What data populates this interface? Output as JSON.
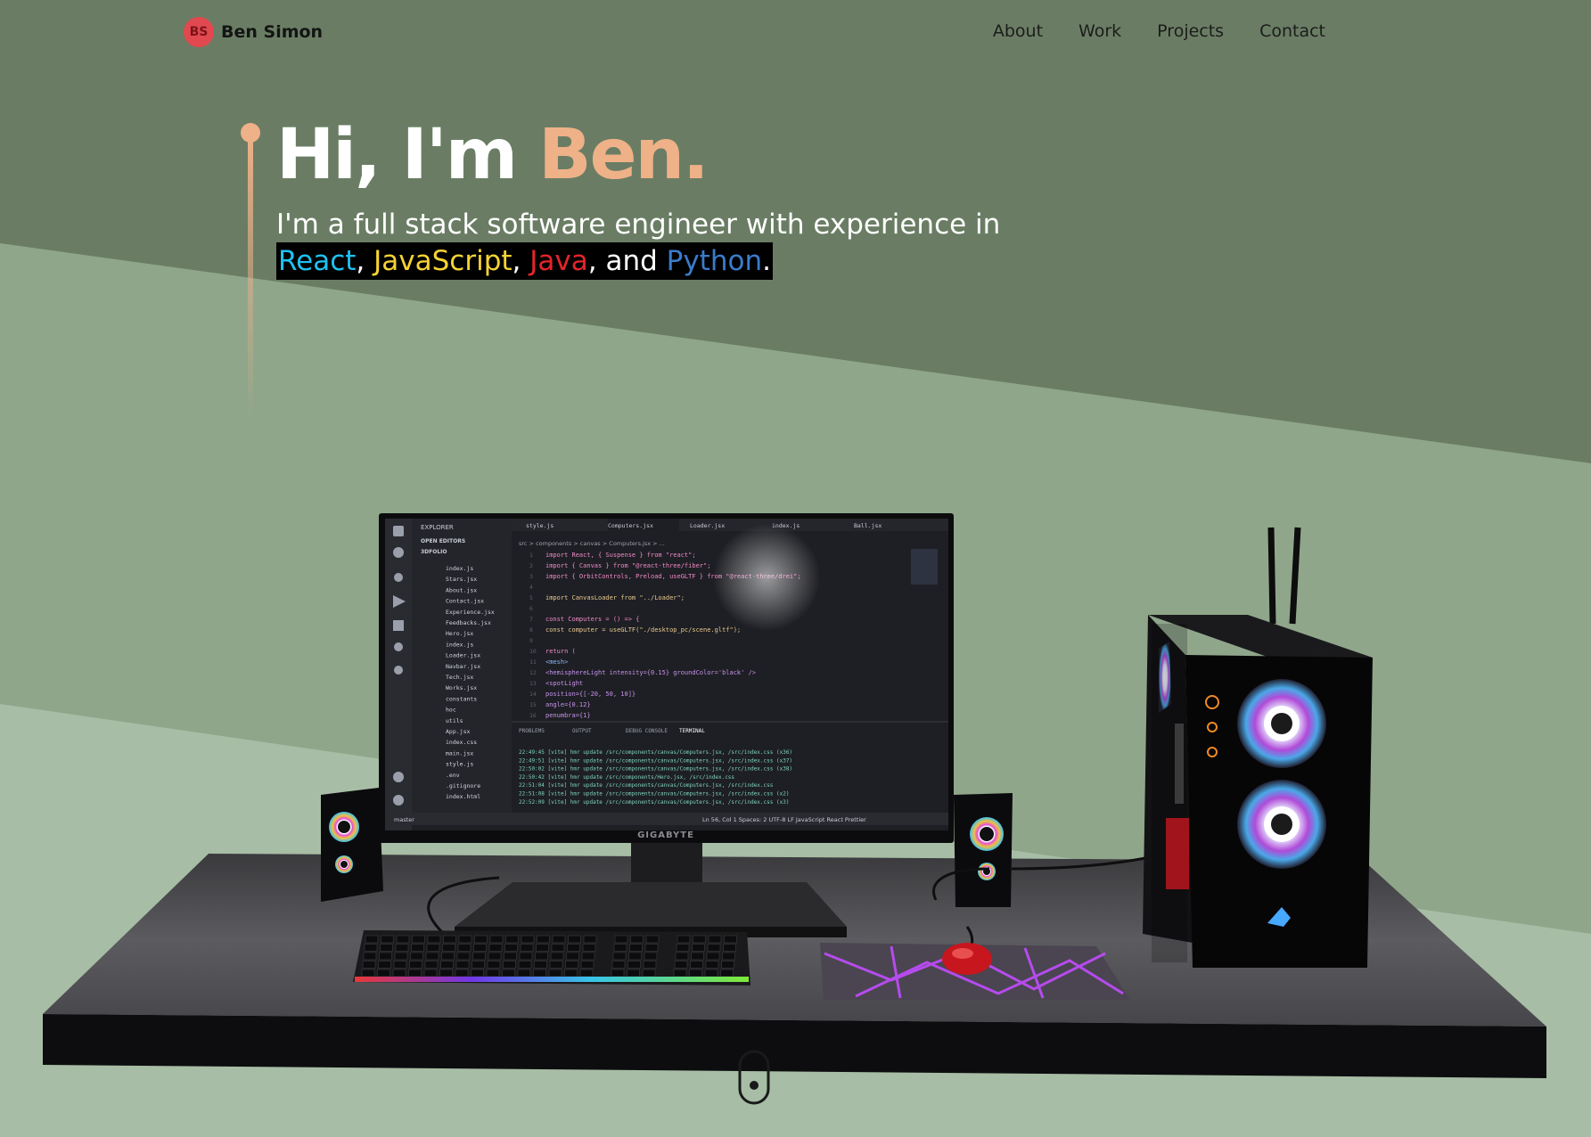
{
  "brand": {
    "logo_text": "BS",
    "name": "Ben Simon"
  },
  "nav": {
    "items": [
      "About",
      "Work",
      "Projects",
      "Contact"
    ]
  },
  "hero": {
    "greeting": "Hi, I'm ",
    "name": "Ben.",
    "subtitle": "I'm a full stack software engineer with experience in",
    "skills": {
      "react": "React",
      "sep1": ", ",
      "javascript": "JavaScript",
      "sep2": ", ",
      "java": "Java",
      "and": ", and ",
      "python": "Python",
      "end": "."
    }
  },
  "monitor": {
    "brand": "GIGABYTE",
    "explorer_title": "EXPLORER",
    "open_editors": "OPEN EDITORS",
    "project": "3DFOLIO",
    "files": [
      "index.js",
      "Stars.jsx",
      "About.jsx",
      "Contact.jsx",
      "Experience.jsx",
      "Feedbacks.jsx",
      "Hero.jsx",
      "index.js",
      "Loader.jsx",
      "Navbar.jsx",
      "Tech.jsx",
      "Works.jsx",
      "constants",
      "hoc",
      "utils",
      "App.jsx",
      "index.css",
      "main.jsx",
      "style.js",
      ".env",
      ".gitignore",
      "index.html"
    ],
    "tabs": [
      "style.js",
      "Computers.jsx",
      "Loader.jsx",
      "index.js",
      "Ball.jsx"
    ],
    "breadcrumb": "src > components > canvas > Computers.jsx > ...",
    "code_lines": [
      "import React, { Suspense } from \"react\";",
      "import { Canvas } from \"@react-three/fiber\";",
      "import { OrbitControls, Preload, useGLTF } from \"@react-three/drei\";",
      "",
      "import CanvasLoader from \"../Loader\";",
      "",
      "const Computers = () => {",
      "  const computer = useGLTF(\"./desktop_pc/scene.gltf\");",
      "",
      "  return (",
      "    <mesh>",
      "      <hemisphereLight intensity={0.15} groundColor='black' />",
      "      <spotLight",
      "        position={[-20, 50, 10]}",
      "        angle={0.12}",
      "        penumbra={1}"
    ],
    "panel_tabs": [
      "PROBLEMS",
      "OUTPUT",
      "DEBUG CONSOLE",
      "TERMINAL"
    ],
    "terminal_lines": [
      "22:49:45 [vite] hmr update /src/components/canvas/Computers.jsx, /src/index.css (x36)",
      "22:49:51 [vite] hmr update /src/components/canvas/Computers.jsx, /src/index.css (x37)",
      "22:50:02 [vite] hmr update /src/components/canvas/Computers.jsx, /src/index.css (x38)",
      "22:50:42 [vite] hmr update /src/components/Hero.jsx, /src/index.css",
      "22:51:04 [vite] hmr update /src/components/canvas/Computers.jsx, /src/index.css",
      "22:51:08 [vite] hmr update /src/components/canvas/Computers.jsx, /src/index.css (x2)",
      "22:52:09 [vite] hmr update /src/components/canvas/Computers.jsx, /src/index.css (x3)"
    ],
    "status_left": "master",
    "status_right": "Ln 56, Col 1   Spaces: 2   UTF-8   LF   JavaScript React   Prettier"
  },
  "colors": {
    "bg_top": "#6a7d64",
    "bg_mid": "#8fa68b",
    "bg_bottom": "#a7bda5",
    "accent": "#efb188",
    "logo": "#e2484f"
  }
}
